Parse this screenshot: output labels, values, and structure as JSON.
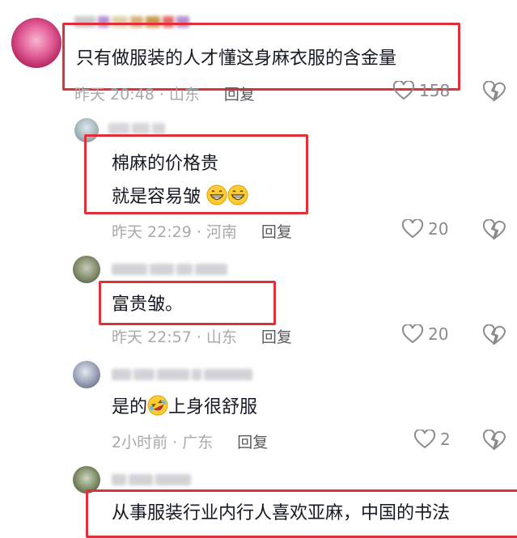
{
  "comments": [
    {
      "text_lines": [
        "只有做服装的人才懂这身麻衣服的含金量"
      ],
      "meta": "昨天 20:48 · 山东",
      "reply_label": "回复",
      "likes": "158"
    },
    {
      "text_lines": [
        "棉麻的价格贵",
        "就是容易皱"
      ],
      "meta": "昨天 22:29 · 河南",
      "reply_label": "回复",
      "likes": "20"
    },
    {
      "text_lines": [
        "富贵皱。"
      ],
      "meta": "昨天 22:57 · 山东",
      "reply_label": "回复",
      "likes": "20"
    },
    {
      "text_lines": [
        "是的",
        "上身很舒服"
      ],
      "meta": "2小时前 · 广东",
      "reply_label": "回复",
      "likes": "2"
    },
    {
      "text_lines": [
        "从事服装行业内行人喜欢亚麻，中国的书法"
      ]
    }
  ],
  "icons": {
    "like": "heart-outline-icon",
    "dislike": "broken-heart-icon",
    "grin": "grinning-face-emoji",
    "laugh_cry": "rolling-laughing-emoji"
  },
  "colors": {
    "highlight_box": "#e2303a",
    "meta_text": "#a8a8ad",
    "body_text": "#161823"
  }
}
